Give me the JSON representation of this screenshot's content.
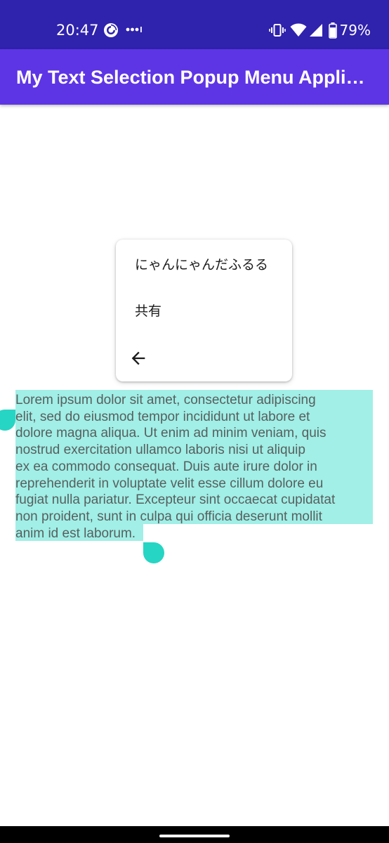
{
  "status_bar": {
    "time": "20:47",
    "app_icon": "pocket-casts-icon",
    "notification_icon": "more-notifications-icon",
    "vibrate_icon": "vibrate-icon",
    "wifi_icon": "wifi-icon",
    "signal_icon": "cell-signal-icon",
    "battery_icon": "battery-icon",
    "battery_percent": "79%",
    "battery_level": 0.79,
    "background_color": "#2f22ac"
  },
  "app_bar": {
    "title": "My Text Selection Popup Menu Application",
    "background_color": "#5e35e5"
  },
  "popup_menu": {
    "items": [
      {
        "label": "にゃんにゃんだふるる"
      },
      {
        "label": "共有"
      }
    ],
    "back_icon": "arrow-back-icon"
  },
  "content": {
    "lines": [
      "Lorem ipsum dolor sit amet, consectetur adipiscing",
      "elit, sed do eiusmod tempor incididunt ut labore et",
      "dolore magna aliqua. Ut enim ad minim veniam, quis",
      "nostrud exercitation ullamco laboris nisi ut aliquip",
      "ex ea commodo consequat. Duis aute irure dolor in",
      "reprehenderit in voluptate velit esse cillum dolore eu",
      "fugiat nulla pariatur. Excepteur sint occaecat cupidatat",
      "non proident, sunt in culpa qui officia deserunt mollit",
      "anim id est laborum."
    ],
    "selection_color": "#a1efe7",
    "handle_color": "#26d5c3"
  }
}
